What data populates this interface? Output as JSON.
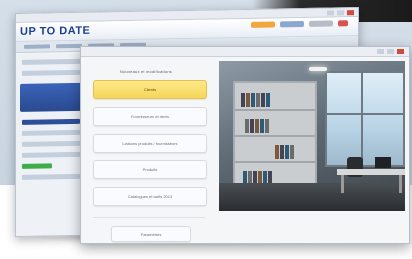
{
  "back_window": {
    "logo": "UP TO DATE"
  },
  "front_window": {
    "panel_heading": "Nouveaux et modifications",
    "menu_items": [
      {
        "label": "Clients"
      },
      {
        "label": "Fournisseurs et devis"
      },
      {
        "label": "Liaisons produits / fournisseurs"
      },
      {
        "label": "Produits"
      },
      {
        "label": "Catalogues et tarifs 2013"
      }
    ],
    "bottom_button": "Paramètres"
  },
  "colors": {
    "active_button": "#f6d65a",
    "logo": "#1b3f8f",
    "close_button": "#d14b3a"
  },
  "icons": [
    "window-close-icon",
    "window-minimize-icon",
    "window-maximize-icon"
  ]
}
